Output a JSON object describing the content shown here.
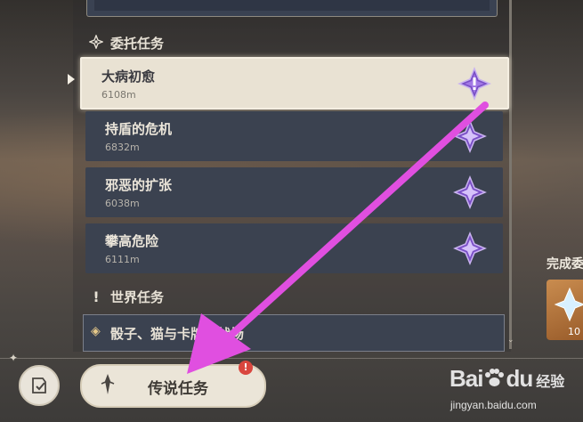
{
  "sections": {
    "commission": "委托任务",
    "world": "世界任务"
  },
  "quests": [
    {
      "name": "大病初愈",
      "distance": "6108m",
      "selected": true,
      "badge": "commission-alert-icon"
    },
    {
      "name": "持盾的危机",
      "distance": "6832m",
      "selected": false,
      "badge": "commission-star-icon"
    },
    {
      "name": "邪恶的扩张",
      "distance": "6038m",
      "selected": false,
      "badge": "commission-star-icon"
    },
    {
      "name": "攀高危险",
      "distance": "6111m",
      "selected": false,
      "badge": "commission-star-icon"
    }
  ],
  "world_quest": {
    "name": "骰子、猫与卡牌的战场"
  },
  "right_panel": {
    "title": "完成委",
    "reward_count": "10"
  },
  "bottom": {
    "legend_button": "传说任务",
    "alert": "!"
  },
  "watermark": {
    "brand": "Bai",
    "brand2": "du",
    "sub": "经验",
    "url": "jingyan.baidu.com"
  },
  "colors": {
    "annotation_arrow": "#e04fe0",
    "commission_purple": "#8a5fd0",
    "selected_bg": "#e9e2d3"
  }
}
